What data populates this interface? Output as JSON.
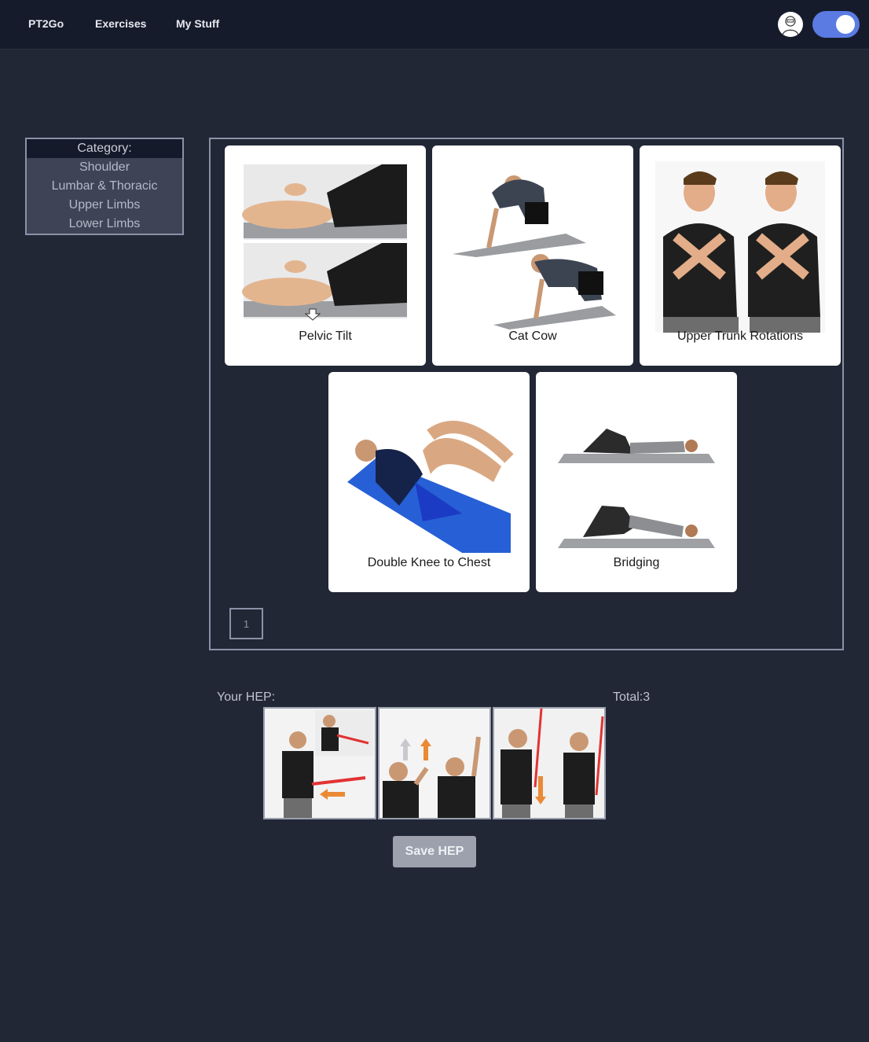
{
  "nav": {
    "brand": "PT2Go",
    "links": [
      "Exercises",
      "My Stuff"
    ],
    "avatar_icon": "user-avatar-icon",
    "toggle_state": "on",
    "accent": "#5b7be3"
  },
  "category": {
    "title": "Category:",
    "items": [
      "Shoulder",
      "Lumbar & Thoracic",
      "Upper Limbs",
      "Lower Limbs"
    ]
  },
  "exercises": [
    {
      "label": "Pelvic Tilt"
    },
    {
      "label": "Cat Cow"
    },
    {
      "label": "Upper Trunk Rotations"
    },
    {
      "label": "Double Knee to Chest"
    },
    {
      "label": "Bridging"
    }
  ],
  "pagination": {
    "current": "1"
  },
  "hep": {
    "label": "Your HEP:",
    "total": "Total:3",
    "save_label": "Save HEP"
  }
}
